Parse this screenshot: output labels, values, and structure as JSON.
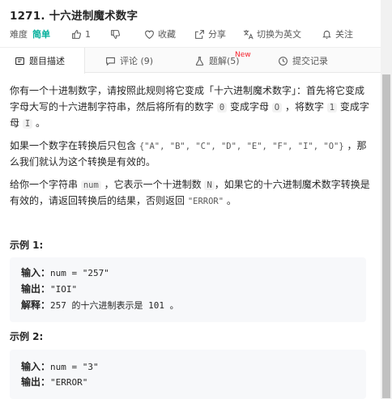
{
  "header": {
    "title": "1271. 十六进制魔术数字",
    "difficulty_label": "难度",
    "difficulty": "简单",
    "likes": "1",
    "favorite_label": "收藏",
    "share_label": "分享",
    "switch_lang_label": "切换为英文",
    "follow_label": "关注"
  },
  "tabs": {
    "description": "题目描述",
    "comments": "评论 (9)",
    "solutions": "题解(5)",
    "solutions_badge": "New",
    "submissions": "提交记录"
  },
  "content": {
    "p1_line1": "你有一个十进制数字，请按照此规则将它变成「十六进制魔术数字」：首先将它变成",
    "p1_line2_a": "字母大写的十六进制字符串，然后将所有的数字 ",
    "p1_code_0": "0",
    "p1_line2_b": " 变成字母 ",
    "p1_code_O": "O",
    "p1_line2_c": " ，将数字 ",
    "p1_code_1": "1",
    "p1_line2_d": " 变成字",
    "p1_line3_a": "母 ",
    "p1_code_I": "I",
    "p1_line3_b": " 。",
    "p2_line1_a": "如果一个数字在转换后只包含 ",
    "p2_code_set": "{\"A\", \"B\", \"C\", \"D\", \"E\", \"F\", \"I\", \"O\"}",
    "p2_line1_b": " ，那",
    "p2_line2": "么我们就认为这个转换是有效的。",
    "p3_line1_a": "给你一个字符串 ",
    "p3_code_num": "num",
    "p3_line1_b": " ，它表示一个十进制数 ",
    "p3_code_N": "N",
    "p3_line1_c": "，如果它的十六进制魔术数字转换是",
    "p3_line2_a": "有效的，请返回转换后的结果，否则返回 ",
    "p3_code_error": "\"ERROR\"",
    "p3_line2_b": " 。"
  },
  "examples": [
    {
      "title": "示例 1:",
      "input_label": "输入：",
      "input_value": "num = \"257\"",
      "output_label": "输出：",
      "output_value": "\"IOI\"",
      "explain_label": "解释：",
      "explain_value": "257 的十六进制表示是 101 。"
    },
    {
      "title": "示例 2:",
      "input_label": "输入：",
      "input_value": "num = \"3\"",
      "output_label": "输出：",
      "output_value": "\"ERROR\""
    }
  ],
  "colors": {
    "easy": "#00af9b",
    "new_badge": "#f5222d",
    "code_bg": "#f2f2f2",
    "example_bg": "#f7f8fa"
  }
}
